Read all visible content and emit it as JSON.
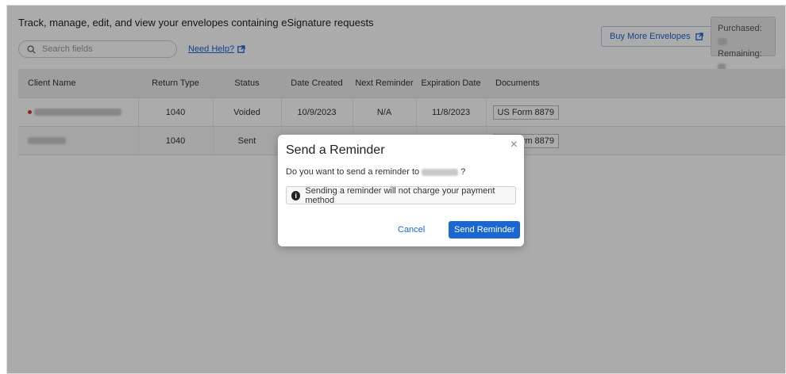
{
  "header": {
    "title": "Track, manage, edit, and view your envelopes containing eSignature requests",
    "search_placeholder": "Search fields",
    "help_link": "Need Help?",
    "buy_button": "Buy More Envelopes",
    "purchased_label": "Purchased:",
    "remaining_label": "Remaining:"
  },
  "table": {
    "columns": [
      "Client Name",
      "Return Type",
      "Status",
      "Date Created",
      "Next Reminder",
      "Expiration Date",
      "Documents"
    ],
    "rows": [
      {
        "return_type": "1040",
        "status": "Voided",
        "date_created": "10/9/2023",
        "next_reminder": "N/A",
        "expiration": "11/8/2023",
        "document": "US Form 8879"
      },
      {
        "return_type": "1040",
        "status": "Sent",
        "date_created": "",
        "next_reminder": "",
        "expiration": "",
        "document": "US Form 8879"
      }
    ]
  },
  "modal": {
    "title": "Send a Reminder",
    "question_prefix": "Do you want to send a reminder to",
    "question_suffix": "?",
    "info": "Sending a reminder will not charge your payment method",
    "cancel": "Cancel",
    "send": "Send Reminder",
    "close": "×"
  },
  "colors": {
    "accent": "#1a66d2",
    "voided": "#c0392b"
  }
}
